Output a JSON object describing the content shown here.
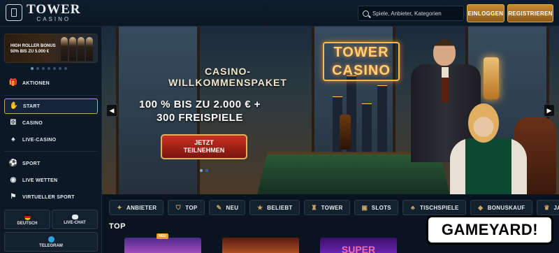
{
  "header": {
    "logo_main": "TOWER",
    "logo_sub": "CASINO",
    "search_placeholder": "Spiele, Anbieter, Kategorien",
    "login_label": "EINLOGGEN",
    "register_label": "REGISTRIEREN",
    "accent_color": "#c88a2e"
  },
  "sidebar": {
    "promo": {
      "line1": "HIGH ROLLER BONUS",
      "line2": "50% BIS ZU 5.000 €"
    },
    "promo_dots": 7,
    "promo_dots_active_index": 0,
    "items": [
      {
        "label": "AKTIONEN",
        "icon": "gift-icon",
        "active": false
      },
      {
        "label": "START",
        "icon": "hand-icon",
        "active": true
      },
      {
        "label": "CASINO",
        "icon": "dice-icon",
        "active": false
      },
      {
        "label": "LIVE-CASINO",
        "icon": "cards-icon",
        "active": false
      },
      {
        "label": "SPORT",
        "icon": "soccer-ball-icon",
        "active": false
      },
      {
        "label": "LIVE WETTEN",
        "icon": "live-signal-icon",
        "active": false
      },
      {
        "label": "VIRTUELLER SPORT",
        "icon": "virtual-sport-icon",
        "active": false
      }
    ],
    "language_label": "DEUTSCH",
    "livechat_label": "LIVE-CHAT",
    "telegram_label": "TELEGRAM"
  },
  "hero": {
    "title_line1": "CASINO-",
    "title_line2": "WILLKOMMENSPAKET",
    "offer_line1": "100 % BIS ZU 2.000 € +",
    "offer_line2": "300 FREISPIELE",
    "cta_line1": "JETZT",
    "cta_line2": "TEILNEHMEN",
    "neon_line1": "TOWER",
    "neon_line2": "CASINO",
    "slides": 2,
    "active_slide": 0
  },
  "categories": [
    {
      "label": "ANBIETER",
      "icon": "provider-icon"
    },
    {
      "label": "TOP",
      "icon": "shield-star-icon"
    },
    {
      "label": "NEU",
      "icon": "new-icon"
    },
    {
      "label": "BELIEBT",
      "icon": "star-icon"
    },
    {
      "label": "TOWER",
      "icon": "tower-icon"
    },
    {
      "label": "SLOTS",
      "icon": "slots-icon"
    },
    {
      "label": "TISCHSPIELE",
      "icon": "table-games-icon"
    },
    {
      "label": "BONUSKAUF",
      "icon": "bonus-buy-icon"
    },
    {
      "label": "JA",
      "icon": "jackpot-icon"
    }
  ],
  "section": {
    "title": "TOP"
  },
  "games": [
    {
      "badge": "NEU",
      "label": ""
    },
    {
      "badge": "",
      "label": ""
    },
    {
      "badge": "",
      "label": "SUPER"
    }
  ],
  "watermark": "GAMEYARD!"
}
